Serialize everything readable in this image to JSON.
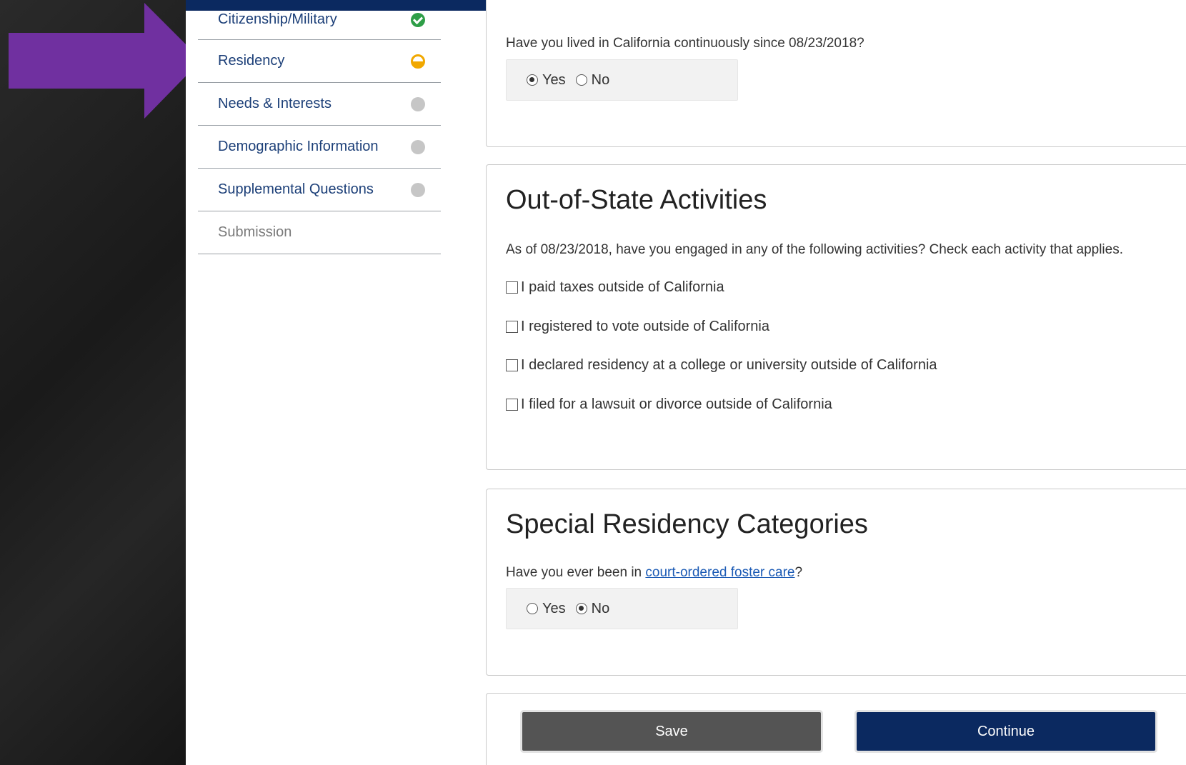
{
  "colors": {
    "header": "#0b2960",
    "arrow": "#7030a0",
    "complete": "#2e9e47",
    "in_progress": "#f1a800",
    "pending": "#c6c6c6",
    "save_button": "#545454",
    "continue_button": "#0b2960"
  },
  "sidebar": {
    "items": [
      {
        "label": "Citizenship/Military",
        "status": "complete",
        "icon": "check-circle-icon"
      },
      {
        "label": "Residency",
        "status": "in-progress",
        "icon": "half-circle-icon"
      },
      {
        "label": "Needs & Interests",
        "status": "pending",
        "icon": "gray-dot-icon"
      },
      {
        "label": "Demographic Information",
        "status": "pending",
        "icon": "gray-dot-icon"
      },
      {
        "label": "Supplemental Questions",
        "status": "pending",
        "icon": "gray-dot-icon"
      },
      {
        "label": "Submission",
        "status": "disabled"
      }
    ]
  },
  "continuous_residence": {
    "question": "Have you lived in California continuously since 08/23/2018?",
    "options": [
      "Yes",
      "No"
    ],
    "selected": "Yes"
  },
  "out_of_state": {
    "title": "Out-of-State Activities",
    "question": "As of 08/23/2018, have you engaged in any of the following activities? Check each activity that applies.",
    "activities": [
      "I paid taxes outside of California",
      "I registered to vote outside of California",
      "I declared residency at a college or university outside of California",
      "I filed for a lawsuit or divorce outside of California"
    ],
    "checked": [
      false,
      false,
      false,
      false
    ]
  },
  "special": {
    "title": "Special Residency Categories",
    "question_prefix": "Have you ever been in ",
    "question_link": "court-ordered foster care",
    "question_suffix": "?",
    "options": [
      "Yes",
      "No"
    ],
    "selected": "No"
  },
  "actions": {
    "save_label": "Save",
    "continue_label": "Continue"
  }
}
